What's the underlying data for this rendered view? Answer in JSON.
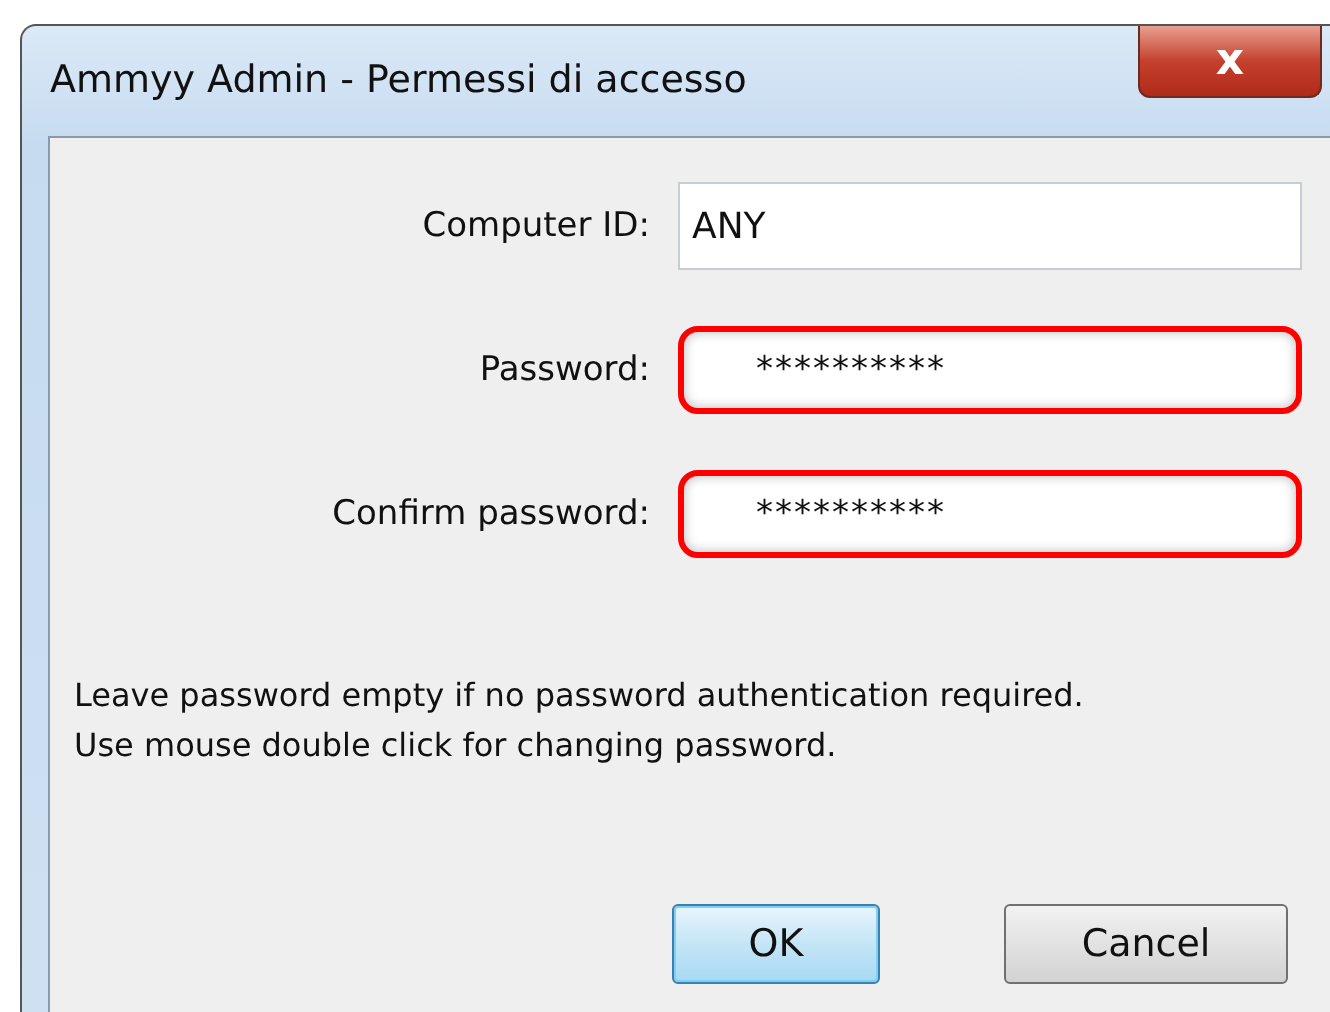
{
  "window": {
    "title": "Ammyy Admin - Permessi di accesso",
    "close_button": "x"
  },
  "fields": [
    {
      "label": "Computer ID:",
      "value": "ANY",
      "highlighted": false
    },
    {
      "label": "Password:",
      "value": "**********",
      "highlighted": true
    },
    {
      "label": "Confirm password:",
      "value": "**********",
      "highlighted": true
    }
  ],
  "notes": [
    "Leave password empty if no password authentication required.",
    "Use mouse double click for changing password."
  ],
  "buttons": [
    {
      "label": "OK",
      "default": true
    },
    {
      "label": "Cancel",
      "default": false
    }
  ]
}
